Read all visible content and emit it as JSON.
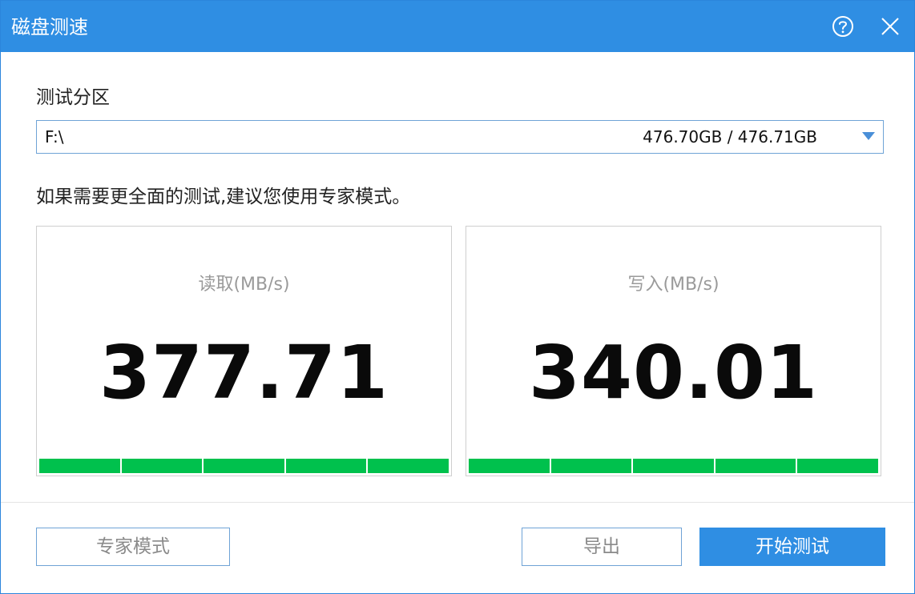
{
  "window": {
    "title": "磁盘测速",
    "help_icon": "question-circle-icon",
    "close_icon": "close-x-icon"
  },
  "partition": {
    "label": "测试分区",
    "drive": "F:\\",
    "capacity": "476.70GB / 476.71GB"
  },
  "hint": "如果需要更全面的测试,建议您使用专家模式。",
  "results": {
    "read": {
      "label": "读取(MB/s)",
      "value": "377.71",
      "progress": 1.0
    },
    "write": {
      "label": "写入(MB/s)",
      "value": "340.01",
      "progress": 1.0
    }
  },
  "buttons": {
    "expert": "专家模式",
    "export": "导出",
    "start": "开始测试"
  },
  "colors": {
    "accent": "#2f8ee3",
    "progress": "#00c14d"
  }
}
